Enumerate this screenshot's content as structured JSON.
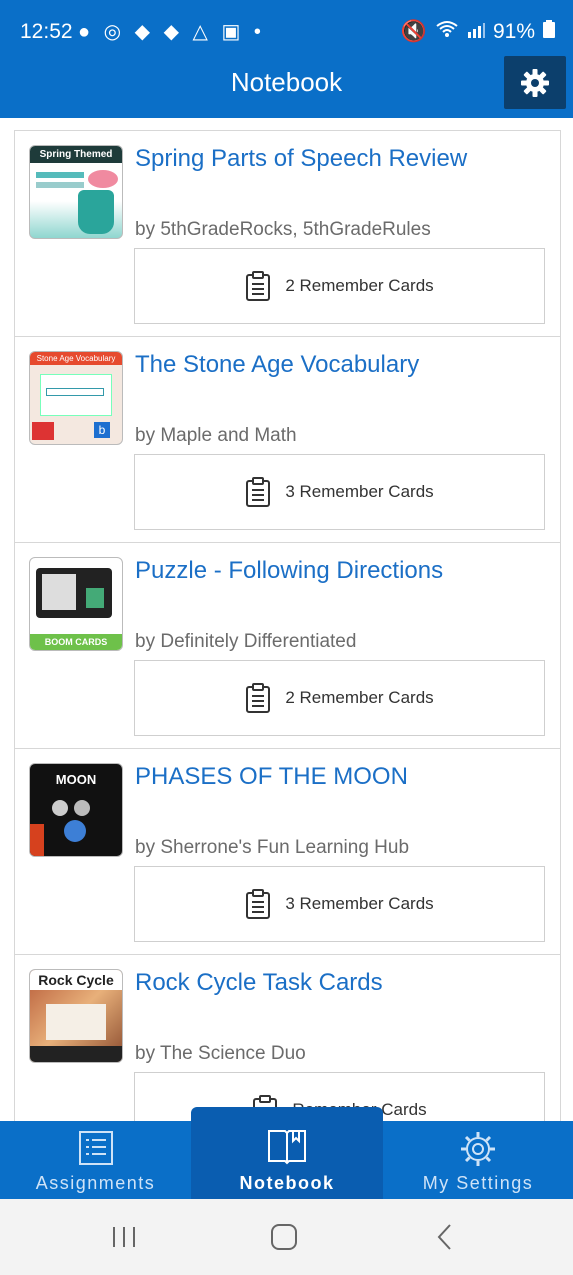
{
  "status_bar": {
    "time": "12:52",
    "left_icons": "● ◎ ◆ ◆ △ ▣ •",
    "battery": "91%"
  },
  "header": {
    "title": "Notebook"
  },
  "items": [
    {
      "title": "Spring Parts of Speech Review",
      "author": "by 5thGradeRocks, 5thGradeRules",
      "cards": "2 Remember Cards",
      "thumb_text": "Spring Themed"
    },
    {
      "title": "The Stone Age Vocabulary",
      "author": "by Maple and Math",
      "cards": "3 Remember Cards",
      "thumb_text": "Stone Age Vocabulary"
    },
    {
      "title": "Puzzle - Following Directions",
      "author": "by Definitely Differentiated",
      "cards": "2 Remember Cards",
      "thumb_text": "BOOM CARDS"
    },
    {
      "title": "PHASES OF THE MOON",
      "author": "by Sherrone's Fun Learning Hub",
      "cards": "3 Remember Cards",
      "thumb_text": "MOON"
    },
    {
      "title": "Rock Cycle Task Cards",
      "author": "by The Science Duo",
      "cards": "Remember Cards",
      "thumb_text": "Rock Cycle"
    }
  ],
  "nav": {
    "assignments": "Assignments",
    "notebook": "Notebook",
    "settings": "My Settings"
  },
  "colors": {
    "brand": "#0a6fc8",
    "title": "#1b6fc6",
    "active_tab": "#0a5db0"
  }
}
